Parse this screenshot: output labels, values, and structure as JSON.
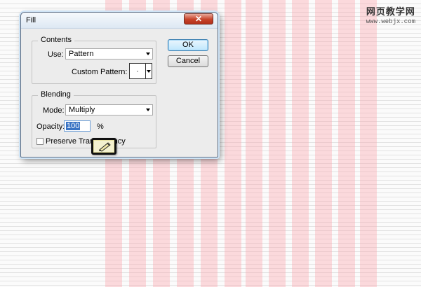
{
  "watermark": {
    "line1": "网页教学网",
    "line2": "www.webjx.com"
  },
  "dialog": {
    "title": "Fill",
    "close_label": "✕",
    "contents": {
      "legend": "Contents",
      "use_label": "Use:",
      "use_value": "Pattern",
      "custom_pattern_label": "Custom Pattern:"
    },
    "blending": {
      "legend": "Blending",
      "mode_label": "Mode:",
      "mode_value": "Multiply",
      "opacity_label": "Opacity:",
      "opacity_value": "100",
      "opacity_unit": "%",
      "preserve_label": "Preserve Transparency",
      "preserve_checked": false
    },
    "ok_label": "OK",
    "cancel_label": "Cancel"
  },
  "colors": {
    "stripe": "#f9b4b8",
    "accent": "#3a74c4"
  }
}
